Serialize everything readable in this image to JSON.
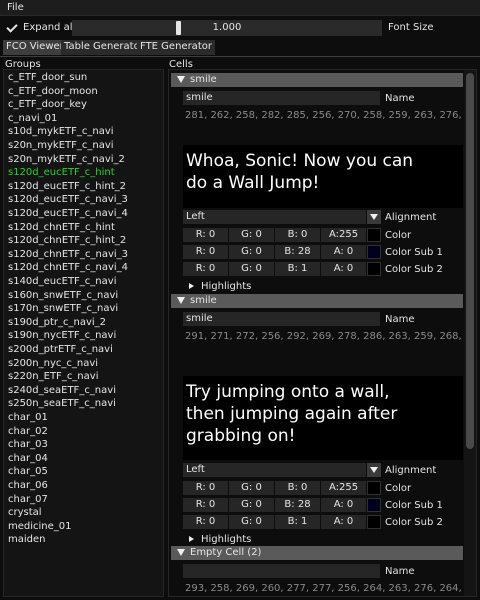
{
  "menu": {
    "file": "File"
  },
  "toolbar": {
    "expand_all": "Expand all",
    "slider_value": "1.000",
    "font_size_label": "Font Size"
  },
  "tabs": [
    "FCO Viewer",
    "Table Generator",
    "FTE Generator"
  ],
  "groups_title": "Groups",
  "cells_title": "Cells",
  "groups": [
    "c_ETF_door_sun",
    "c_ETF_door_moon",
    "c_ETF_door_key",
    "c_navi_01",
    "s10d_mykETF_c_navi",
    "s20n_mykETF_c_navi",
    "s20n_mykETF_c_navi_2",
    "s120d_eucETF_c_hint",
    "s120d_eucETF_c_hint_2",
    "s120d_eucETF_c_navi_3",
    "s120d_eucETF_c_navi_4",
    "s120d_chnETF_c_hint",
    "s120d_chnETF_c_hint_2",
    "s120d_chnETF_c_navi_3",
    "s120d_chnETF_c_navi_4",
    "s140d_eucETF_c_navi",
    "s160n_snwETF_c_navi",
    "s170n_snwETF_c_navi",
    "s190d_ptr_c_navi_2",
    "s190n_nycETF_c_navi",
    "s200d_ptrETF_c_navi",
    "s200n_nyc_c_navi",
    "s220n_ETF_c_navi",
    "s240d_seaETF_c_navi",
    "s250n_seaETF_c_navi",
    "char_01",
    "char_02",
    "char_03",
    "char_04",
    "char_05",
    "char_06",
    "char_07",
    "crystal",
    "medicine_01",
    "maiden"
  ],
  "selected_group_index": 7,
  "cells": [
    {
      "title": "smile",
      "name_value": "smile",
      "name_label": "Name",
      "codes": "281, 262, 258, 282, 285, 256, 270, 258, 259, 263, 276, 279, 256, 28",
      "text_lines": [
        "Whoa, Sonic! Now you can",
        "do a Wall Jump!"
      ],
      "alignment_value": "Left",
      "alignment_label": "Alignment",
      "colors": [
        {
          "label": "Color",
          "r": "R: 0",
          "g": "G: 0",
          "b": "B: 0",
          "a": "A:255",
          "swatch": "#000000"
        },
        {
          "label": "Color Sub 1",
          "r": "R: 0",
          "g": "G: 0",
          "b": "B: 28",
          "a": "A: 0",
          "swatch": "#00001c"
        },
        {
          "label": "Color Sub 2",
          "r": "R: 0",
          "g": "G: 0",
          "b": "B: 1",
          "a": "A: 0",
          "swatch": "#000001"
        }
      ],
      "highlights_label": "Highlights"
    },
    {
      "title": "smile",
      "name_value": "smile",
      "name_label": "Name",
      "codes": "291, 271, 272, 256, 292, 269, 278, 286, 263, 259, 268, 256, 258, 25",
      "text_lines": [
        "Try jumping onto a wall,",
        "then jumping again after",
        "grabbing on!"
      ],
      "alignment_value": "Left",
      "alignment_label": "Alignment",
      "colors": [
        {
          "label": "Color",
          "r": "R: 0",
          "g": "G: 0",
          "b": "B: 0",
          "a": "A:255",
          "swatch": "#000000"
        },
        {
          "label": "Color Sub 1",
          "r": "R: 0",
          "g": "G: 0",
          "b": "B: 28",
          "a": "A: 0",
          "swatch": "#00001c"
        },
        {
          "label": "Color Sub 2",
          "r": "R: 0",
          "g": "G: 0",
          "b": "B: 1",
          "a": "A: 0",
          "swatch": "#000001"
        }
      ],
      "highlights_label": "Highlights"
    },
    {
      "title": "Empty Cell (2)",
      "name_value": "",
      "name_label": "Name",
      "codes": "293, 258, 269, 260, 277, 277, 256, 264, 263, 276, 264, 256, 258, 28"
    }
  ]
}
